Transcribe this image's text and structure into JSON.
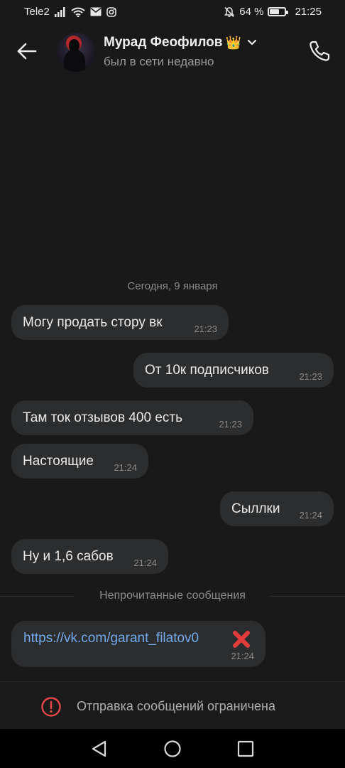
{
  "status_bar": {
    "carrier": "Tele2",
    "battery_percent_label": "64 %",
    "battery_level": 0.64,
    "time": "21:25",
    "icons": [
      "signal-icon",
      "wifi-icon",
      "mail-icon",
      "instagram-icon",
      "mute-icon",
      "battery-icon"
    ]
  },
  "header": {
    "contact_name": "Мурад Феофилов",
    "crown": "👑",
    "status": "был в сети недавно",
    "icons": [
      "back-arrow-icon",
      "chevron-down-icon",
      "phone-icon"
    ]
  },
  "chat": {
    "date_separator": "Сегодня, 9 января",
    "messages": [
      {
        "text": "Могу продать стору вк",
        "time": "21:23",
        "outgoing": false
      },
      {
        "text": "От 10к подписчиков",
        "time": "21:23",
        "outgoing": true
      },
      {
        "text": "Там ток отзывов 400 есть",
        "time": "21:23",
        "outgoing": false
      },
      {
        "text": "Настоящие",
        "time": "21:24",
        "outgoing": false
      },
      {
        "text": "Сыллки",
        "time": "21:24",
        "outgoing": true
      },
      {
        "text": "Ну и 1,6 сабов",
        "time": "21:24",
        "outgoing": false
      }
    ],
    "unread_separator": "Непрочитанные сообщения",
    "link_message": {
      "url": "https://vk.com/garant_filatov0",
      "emoji": "x-mark-icon",
      "time": "21:24"
    }
  },
  "restriction": {
    "text": "Отправка сообщений ограничена",
    "icon": "warning-circle-icon",
    "accent": "#e64646"
  },
  "nav": {
    "icons": [
      "nav-back-icon",
      "nav-home-icon",
      "nav-recents-icon"
    ]
  },
  "colors": {
    "background": "#191919",
    "bubble": "#2c2d2e",
    "link": "#71aaeb",
    "red_x": "#e23b3b"
  }
}
